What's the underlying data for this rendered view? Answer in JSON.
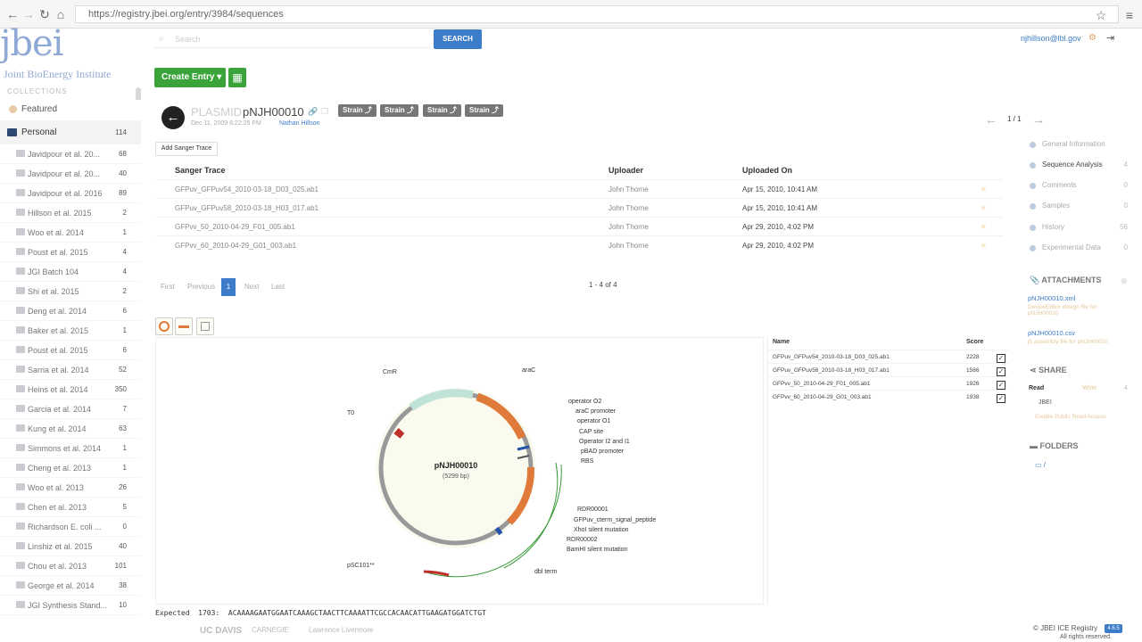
{
  "browser": {
    "url": "https://registry.jbei.org/entry/3984/sequences"
  },
  "brand": {
    "logo": "jbei",
    "subtitle": "Joint BioEnergy Institute"
  },
  "header": {
    "search_placeholder": "Search",
    "search_button": "SEARCH",
    "user": "njhillson@lbl.gov"
  },
  "toolbar": {
    "create_entry": "Create Entry ▾"
  },
  "sidebar": {
    "collections_label": "COLLECTIONS",
    "featured": "Featured",
    "personal": {
      "label": "Personal",
      "count": "114"
    },
    "items": [
      {
        "label": "Javidpour et al. 20...",
        "count": "68"
      },
      {
        "label": "Javidpour et al. 20...",
        "count": "40"
      },
      {
        "label": "Javidpour et al. 2016",
        "count": "89"
      },
      {
        "label": "Hillson et al. 2015",
        "count": "2"
      },
      {
        "label": "Woo et al. 2014",
        "count": "1"
      },
      {
        "label": "Poust et al. 2015",
        "count": "4"
      },
      {
        "label": "JGI Batch 104",
        "count": "4"
      },
      {
        "label": "Shi et al. 2015",
        "count": "2"
      },
      {
        "label": "Deng et al. 2014",
        "count": "6"
      },
      {
        "label": "Baker et al. 2015",
        "count": "1"
      },
      {
        "label": "Poust et al. 2015",
        "count": "6"
      },
      {
        "label": "Sarria et al. 2014",
        "count": "52"
      },
      {
        "label": "Heins et al. 2014",
        "count": "350"
      },
      {
        "label": "Garcia et al. 2014",
        "count": "7"
      },
      {
        "label": "Kung et al. 2014",
        "count": "63"
      },
      {
        "label": "Simmons et al. 2014",
        "count": "1"
      },
      {
        "label": "Cheng et al. 2013",
        "count": "1"
      },
      {
        "label": "Woo et al. 2013",
        "count": "26"
      },
      {
        "label": "Chen et al. 2013",
        "count": "5"
      },
      {
        "label": "Richardson E. coli ...",
        "count": "0"
      },
      {
        "label": "Linshiz et al. 2015",
        "count": "40"
      },
      {
        "label": "Chou et al. 2013",
        "count": "101"
      },
      {
        "label": "George et al. 2014",
        "count": "38"
      },
      {
        "label": "JGI Synthesis Stand...",
        "count": "10"
      }
    ]
  },
  "entry": {
    "type": "PLASMID",
    "name": "pNJH00010",
    "strains": [
      "Strain ⤴",
      "Strain ⤴",
      "Strain ⤴",
      "Strain ⤴"
    ],
    "date": "Dec 11, 2009 6:22:25 PM",
    "owner": "Nathan Hillson",
    "pager": "1 / 1"
  },
  "sanger": {
    "add_button": "Add Sanger Trace",
    "columns": [
      "Sanger Trace",
      "Uploader",
      "Uploaded On"
    ],
    "rows": [
      {
        "file": "GFPuv_GFPuv54_2010-03-18_D03_025.ab1",
        "uploader": "John Thorne",
        "date": "Apr 15, 2010, 10:41 AM"
      },
      {
        "file": "GFPuv_GFPuv58_2010-03-18_H03_017.ab1",
        "uploader": "John Thorne",
        "date": "Apr 15, 2010, 10:41 AM"
      },
      {
        "file": "GFPvv_50_2010-04-29_F01_005.ab1",
        "uploader": "John Thorne",
        "date": "Apr 29, 2010, 4:02 PM"
      },
      {
        "file": "GFPvv_60_2010-04-29_G01_003.ab1",
        "uploader": "John Thorne",
        "date": "Apr 29, 2010, 4:02 PM"
      }
    ],
    "pagination": {
      "first": "First",
      "previous": "Previous",
      "current": "1",
      "next": "Next",
      "last": "Last"
    },
    "count": "1 - 4 of 4"
  },
  "plasmid_map": {
    "name": "pNJH00010",
    "size": "(5299 bp)",
    "labels": [
      "CmR",
      "araC",
      "T0",
      "operator O2",
      "araC promoter",
      "operator O1",
      "CAP site",
      "Operator I2 and I1",
      "pBAD promoter",
      "RBS",
      "RDR00001",
      "GFPuv_cterm_signal_peptide",
      "XhoI silent mutation",
      "RDR00002",
      "BamHI silent mutation",
      "pSC101**",
      "dbl term"
    ]
  },
  "traces_panel": {
    "col_name": "Name",
    "col_score": "Score",
    "rows": [
      {
        "name": "GFPuv_GFPuv54_2010-03-18_D03_025.ab1",
        "score": "2228"
      },
      {
        "name": "GFPuv_GFPuv58_2010-03-18_H03_017.ab1",
        "score": "1566"
      },
      {
        "name": "GFPvv_50_2010-04-29_F01_005.ab1",
        "score": "1926"
      },
      {
        "name": "GFPvv_60_2010-04-29_G01_003.ab1",
        "score": "1938"
      }
    ]
  },
  "sequence": {
    "line": "Expected  1703:  ACAAAAGAATGGAATCAAAGCTAACTTCAAAATTCGCCACAACATTGAAGATGGATCTGT"
  },
  "right_nav": {
    "items": [
      {
        "label": "General Information",
        "count": ""
      },
      {
        "label": "Sequence Analysis",
        "count": "4"
      },
      {
        "label": "Comments",
        "count": "0"
      },
      {
        "label": "Samples",
        "count": "0"
      },
      {
        "label": "History",
        "count": "56"
      },
      {
        "label": "Experimental Data",
        "count": "0"
      }
    ],
    "attachments_title": "ATTACHMENTS",
    "attachments": [
      {
        "file": "pNJH00010.xml",
        "desc": "DeviceEditor design file for pNJH00010"
      },
      {
        "file": "pNJH00010.csv",
        "desc": "j5 assembly file for pNJH00010"
      }
    ],
    "share_title": "SHARE",
    "share_read": "Read",
    "share_write": "Write",
    "share_count": "4",
    "share_group": "JBEI",
    "share_public": "Enable Public Read Access",
    "folders_title": "FOLDERS",
    "folders_root": "/"
  },
  "footer": {
    "copyright": "© JBEI ICE Registry",
    "version": "4.6.5",
    "rights": "All rights reserved.",
    "partners": [
      "UC DAVIS",
      "CARNEGIE",
      "Lawrence Livermore"
    ]
  }
}
